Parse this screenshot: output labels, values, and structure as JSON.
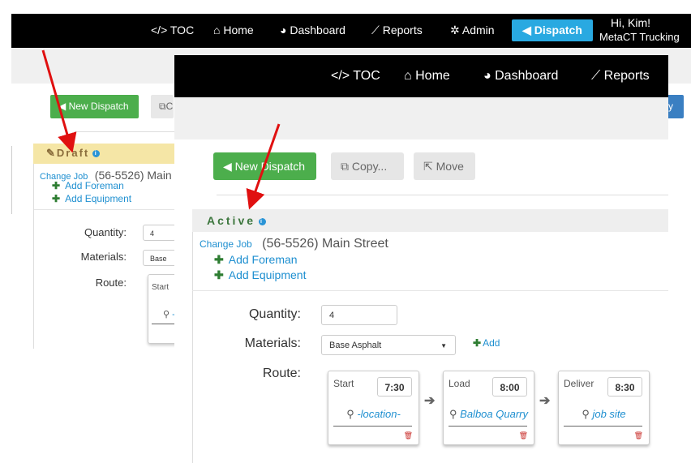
{
  "back": {
    "nav": {
      "toc": "</> TOC",
      "home": "Home",
      "dashboard": "Dashboard",
      "reports": "Reports",
      "admin": "Admin",
      "dispatch": "Dispatch",
      "greeting": "Hi, Kim!",
      "company": "MetaCT Trucking"
    },
    "new_dispatch": "New Dispatch",
    "copy_partial": "C",
    "right_partial": "y",
    "panel": {
      "title": "Draft",
      "change_job": "Change Job",
      "job": "(56-5526) Main",
      "add_foreman": "Add Foreman",
      "add_equipment": "Add Equipment",
      "quantity_label": "Quantity:",
      "quantity_value": "4",
      "materials_label": "Materials:",
      "materials_value": "Base As",
      "route_label": "Route:",
      "start_label": "Start",
      "location_partial": "-"
    }
  },
  "front": {
    "nav": {
      "toc": "</> TOC",
      "home": "Home",
      "dashboard": "Dashboard",
      "reports": "Reports"
    },
    "toolbar": {
      "new_dispatch": "New Dispatch",
      "copy": "Copy...",
      "move": "Move"
    },
    "panel": {
      "title": "Active",
      "change_job": "Change Job",
      "job": "(56-5526) Main Street",
      "add_foreman": "Add Foreman",
      "add_equipment": "Add Equipment",
      "quantity_label": "Quantity:",
      "quantity_value": "4",
      "materials_label": "Materials:",
      "materials_value": "Base Asphalt",
      "add_material": "Add",
      "route_label": "Route:",
      "stops": [
        {
          "label": "Start",
          "time": "7:30",
          "location": "-location-"
        },
        {
          "label": "Load",
          "time": "8:00",
          "location": "Balboa Quarry"
        },
        {
          "label": "Deliver",
          "time": "8:30",
          "location": "job site"
        }
      ]
    }
  },
  "colors": {
    "nav_bg": "#000000",
    "dispatch_accent": "#29a9e1",
    "success_green": "#4cae4c",
    "draft_header": "#f5e6a6",
    "link_blue": "#1e8fd0",
    "annotation_red": "#e01010"
  }
}
